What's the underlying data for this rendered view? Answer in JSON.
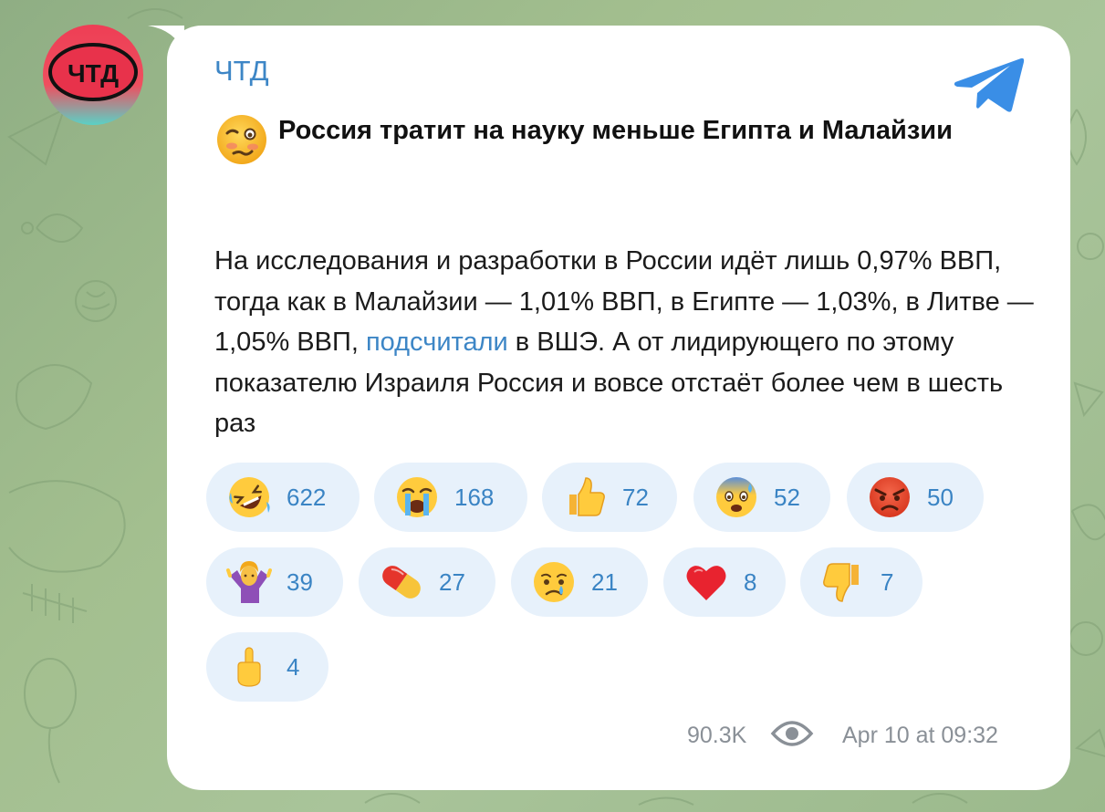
{
  "channel": {
    "name": "ЧТД",
    "avatar_text": "ЧТД"
  },
  "post": {
    "title": "Россия тратит на науку меньше Египта и Малайзии",
    "title_emoji": "woozy-face",
    "body_part1": "На исследования и разработки в России идёт лишь 0,97% ВВП, тогда как в Малайзии — 1,01% ВВП, в Египте — 1,03%, в Литве — 1,05% ВВП, ",
    "body_link": "подсчитали",
    "body_part2": " в ВШЭ. А от лидирующего по этому показателю Израиля Россия и вовсе отстаёт более чем в шесть раз"
  },
  "reactions": [
    {
      "emoji": "rolling-on-floor-laughing",
      "count": "622"
    },
    {
      "emoji": "loudly-crying-face",
      "count": "168"
    },
    {
      "emoji": "thumbs-up",
      "count": "72"
    },
    {
      "emoji": "anxious-face-with-sweat",
      "count": "52"
    },
    {
      "emoji": "angry-face",
      "count": "50"
    },
    {
      "emoji": "person-shrugging",
      "count": "39"
    },
    {
      "emoji": "pill",
      "count": "27"
    },
    {
      "emoji": "crying-face",
      "count": "21"
    },
    {
      "emoji": "red-heart",
      "count": "8"
    },
    {
      "emoji": "thumbs-down",
      "count": "7"
    },
    {
      "emoji": "middle-finger",
      "count": "4"
    }
  ],
  "footer": {
    "views": "90.3K",
    "date": "Apr 10 at 09:32"
  },
  "colors": {
    "accent": "#3d86c6",
    "reaction_bg": "#e7f1fb",
    "meta_gray": "#8a9097",
    "bubble_bg": "#ffffff",
    "wallpaper": "#a3bf8f"
  }
}
